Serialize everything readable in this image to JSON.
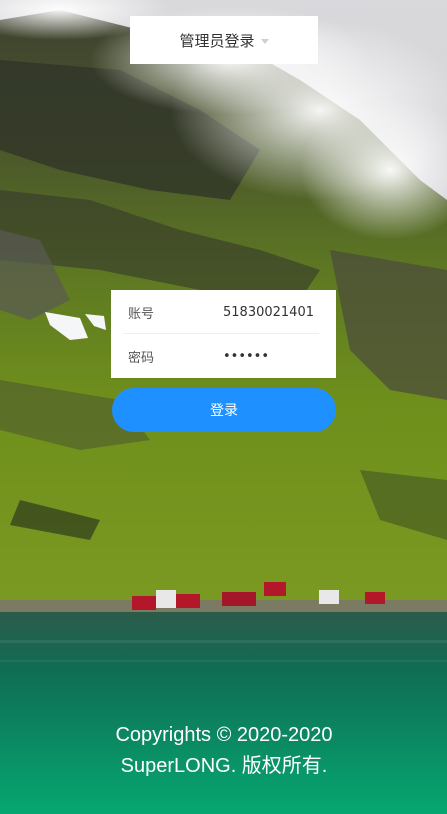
{
  "header": {
    "role_select": {
      "value": "管理员登录",
      "caret_icon": "chevron-down-icon"
    }
  },
  "login_form": {
    "account": {
      "label": "账号",
      "value": "51830021401"
    },
    "password": {
      "label": "密码",
      "value": "••••••"
    },
    "submit_label": "登录",
    "accent_color": "#1e90ff"
  },
  "footer": {
    "copyright": "Copyrights © 2020-2020 SuperLONG. 版权所有."
  }
}
